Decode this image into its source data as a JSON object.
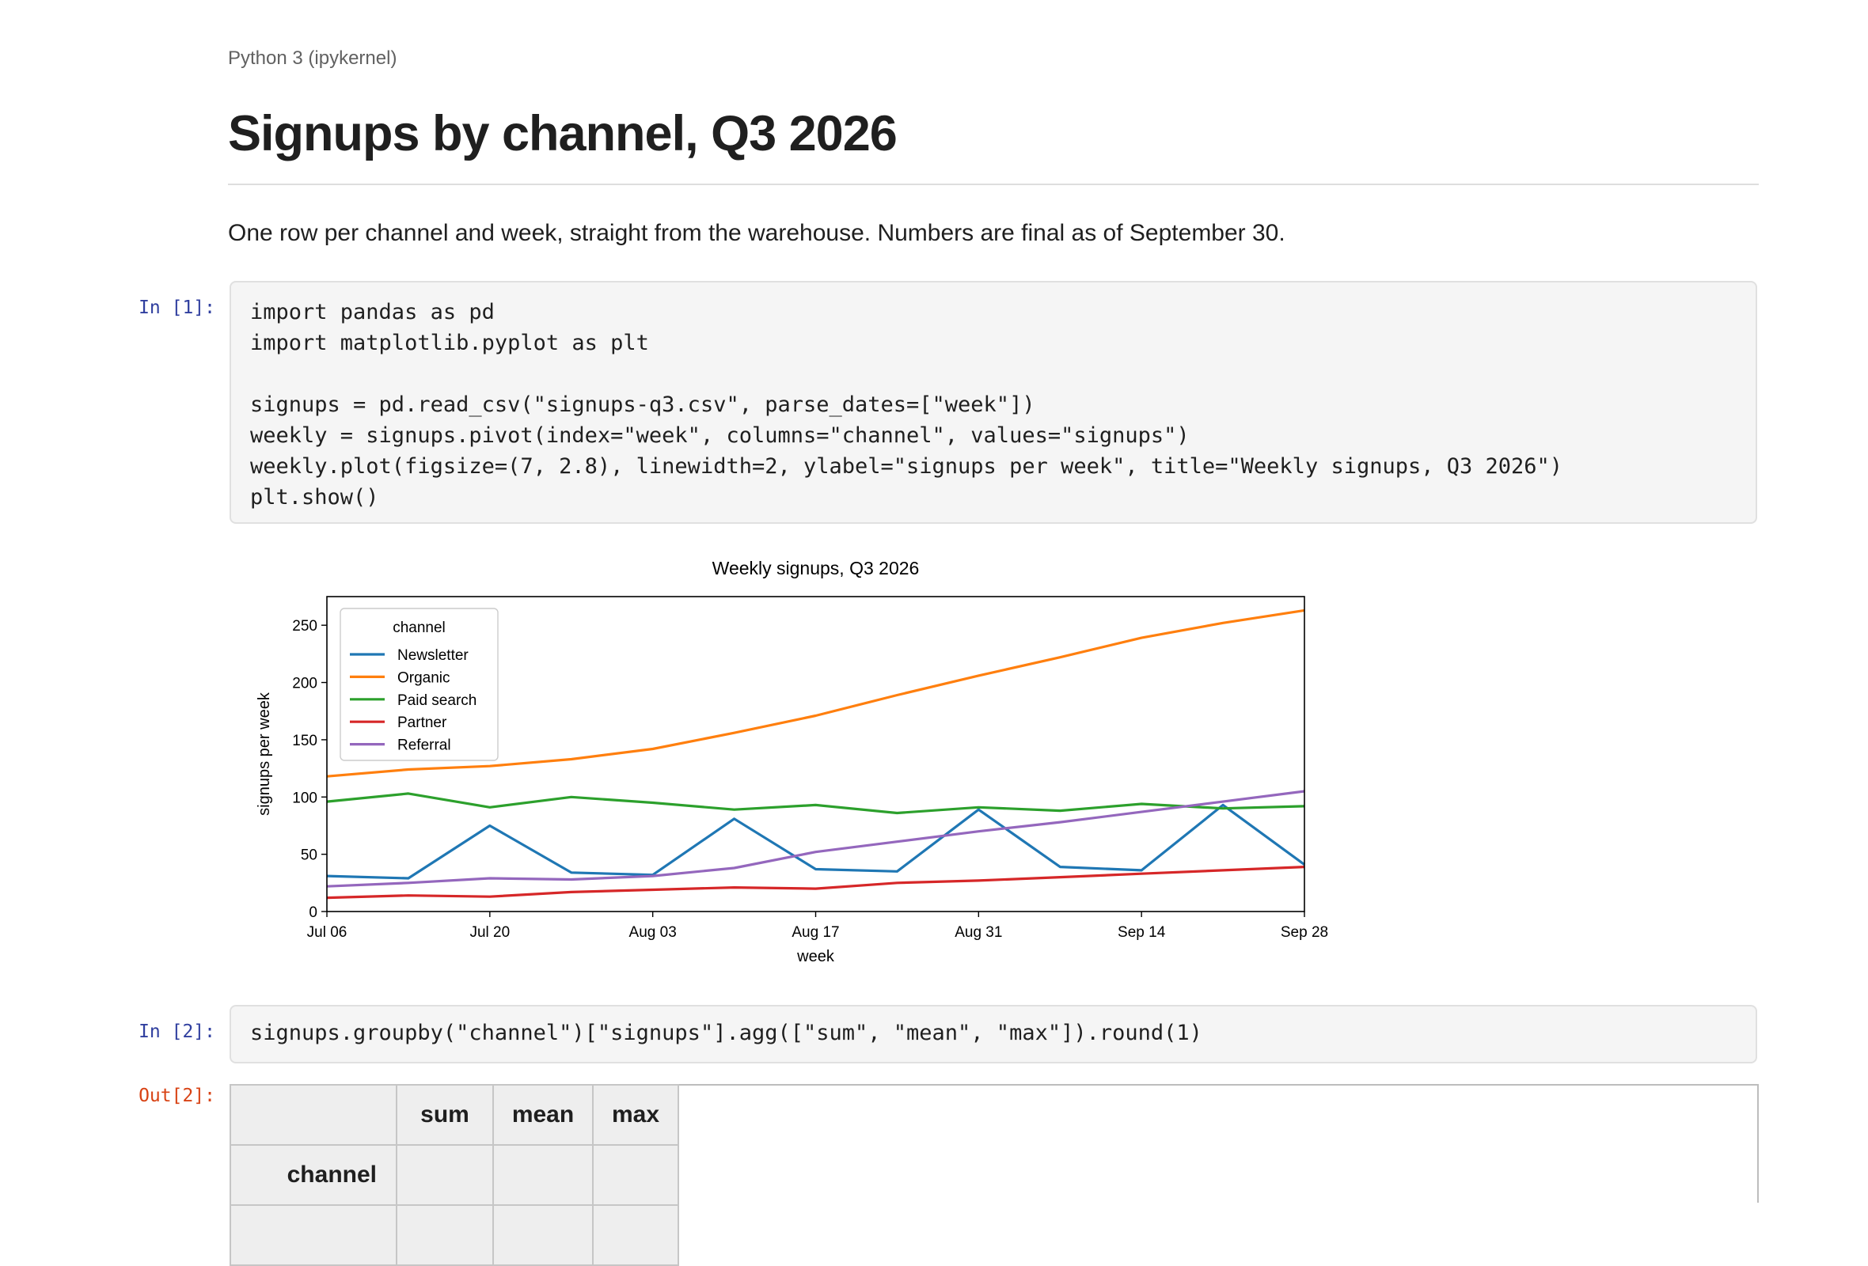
{
  "kernel": "Python 3 (ipykernel)",
  "title": "Signups by channel, Q3 2026",
  "description": "One row per channel and week, straight from the warehouse. Numbers are final as of September 30.",
  "cells": [
    {
      "prompt": "In [1]:",
      "code": "import pandas as pd\nimport matplotlib.pyplot as plt\n\nsignups = pd.read_csv(\"signups-q3.csv\", parse_dates=[\"week\"])\nweekly = signups.pivot(index=\"week\", columns=\"channel\", values=\"signups\")\nweekly.plot(figsize=(7, 2.8), linewidth=2, ylabel=\"signups per week\", title=\"Weekly signups, Q3 2026\")\nplt.show()"
    },
    {
      "prompt": "In [2]:",
      "code": "signups.groupby(\"channel\")[\"signups\"].agg([\"sum\", \"mean\", \"max\"]).round(1)"
    }
  ],
  "output_prompt": "Out[2]:",
  "table": {
    "columns": [
      "sum",
      "mean",
      "max"
    ],
    "index_name": "channel"
  },
  "chart_data": {
    "type": "line",
    "title": "Weekly signups, Q3 2026",
    "xlabel": "week",
    "ylabel": "signups per week",
    "x": [
      "Jul 06",
      "Jul 13",
      "Jul 20",
      "Jul 27",
      "Aug 03",
      "Aug 10",
      "Aug 17",
      "Aug 24",
      "Aug 31",
      "Sep 07",
      "Sep 14",
      "Sep 21",
      "Sep 28"
    ],
    "xticks": [
      "Jul 06",
      "Jul 20",
      "Aug 03",
      "Aug 17",
      "Aug 31",
      "Sep 14",
      "Sep 28"
    ],
    "ylim": [
      0,
      275
    ],
    "yticks": [
      0,
      50,
      100,
      150,
      200,
      250
    ],
    "legend_title": "channel",
    "legend_position": "upper left",
    "grid": false,
    "series": [
      {
        "name": "Newsletter",
        "color": "#1f77b4",
        "values": [
          31,
          29,
          75,
          34,
          32,
          81,
          37,
          35,
          89,
          39,
          36,
          93,
          41
        ]
      },
      {
        "name": "Organic",
        "color": "#ff7f0e",
        "values": [
          118,
          124,
          127,
          133,
          142,
          156,
          171,
          189,
          206,
          222,
          239,
          252,
          263
        ]
      },
      {
        "name": "Paid search",
        "color": "#2ca02c",
        "values": [
          96,
          103,
          91,
          100,
          95,
          89,
          93,
          86,
          91,
          88,
          94,
          90,
          92
        ]
      },
      {
        "name": "Partner",
        "color": "#d62728",
        "values": [
          12,
          14,
          13,
          17,
          19,
          21,
          20,
          25,
          27,
          30,
          33,
          36,
          39
        ]
      },
      {
        "name": "Referral",
        "color": "#9467bd",
        "values": [
          22,
          25,
          29,
          28,
          31,
          38,
          52,
          61,
          70,
          78,
          87,
          96,
          105
        ]
      }
    ]
  }
}
